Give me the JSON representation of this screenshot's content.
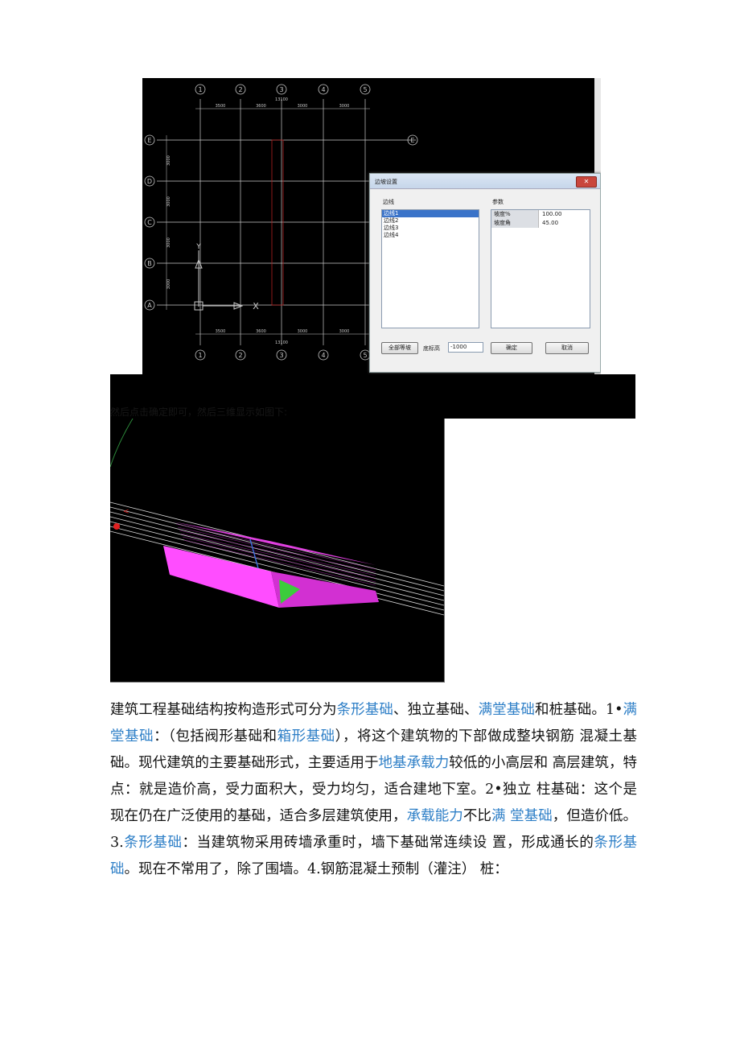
{
  "cad": {
    "axis_top": [
      "①",
      "②",
      "③",
      "④",
      "⑤"
    ],
    "axis_bottom": [
      "①",
      "②",
      "③",
      "④",
      "⑤"
    ],
    "axis_left": [
      "Ⓔ",
      "Ⓓ",
      "Ⓒ",
      "Ⓑ",
      "Ⓐ"
    ],
    "axis_right": [
      "Ⓔ"
    ],
    "dims_top": [
      "3500",
      "3600",
      "3000",
      "3000"
    ],
    "dims_bottom": [
      "3500",
      "3600",
      "3000",
      "3000"
    ],
    "total_top": "13100",
    "total_bottom": "13100",
    "dims_left": [
      "3000",
      "3000",
      "3000",
      "3000"
    ],
    "ucs_y": "Y",
    "ucs_x": "X"
  },
  "dialog": {
    "title": "边坡设置",
    "close": "✕",
    "edges_label": "边线",
    "params_label": "参数",
    "edges": [
      "边线1",
      "边线2",
      "边线3",
      "边线4"
    ],
    "selected_edge": 0,
    "params": [
      {
        "key": "坡度%",
        "value": "100.00"
      },
      {
        "key": "坡度角",
        "value": "45.00"
      }
    ],
    "all_equal_button": "全部等坡",
    "base_elev_label": "底标高",
    "base_elev_value": "-1000",
    "ok_button": "确定",
    "cancel_button": "取消"
  },
  "caption": "然后点击确定即可，然后三维显示如图下:",
  "paragraph": [
    {
      "t": "建筑工程基础结构按构造形式可分为"
    },
    {
      "t": "条形基础",
      "link": true
    },
    {
      "t": "、独立基础、"
    },
    {
      "t": "满堂基础",
      "link": true
    },
    {
      "t": "和桩基础。1•"
    },
    {
      "t": "满堂基础",
      "link": true
    },
    {
      "t": "：（包括阀形基础和"
    },
    {
      "t": "箱形基础",
      "link": true
    },
    {
      "t": "），将这个建筑物的下部做成整块钢筋 混凝土基础。现代建筑的主要基础形式，主要适用于"
    },
    {
      "t": "地基承载力",
      "link": true
    },
    {
      "t": "较低的小高层和 高层建筑，特点：就是造价高，受力面积大，受力均匀，适合建地下室。2•独立 柱基础：这个是现在仍在广泛使用的基础，适合多层建筑使用，"
    },
    {
      "t": "承载能力",
      "link": true
    },
    {
      "t": "不比"
    },
    {
      "t": "满 堂基础",
      "link": true
    },
    {
      "t": "，但造价低。3."
    },
    {
      "t": "条形基础",
      "link": true
    },
    {
      "t": "：当建筑物采用砖墙承重时，墙下基础常连续设 置，形成通长的"
    },
    {
      "t": "条形基础",
      "link": true
    },
    {
      "t": "。现在不常用了，除了围墙。4.钢筋混凝土预制（灌注） 桩："
    }
  ]
}
